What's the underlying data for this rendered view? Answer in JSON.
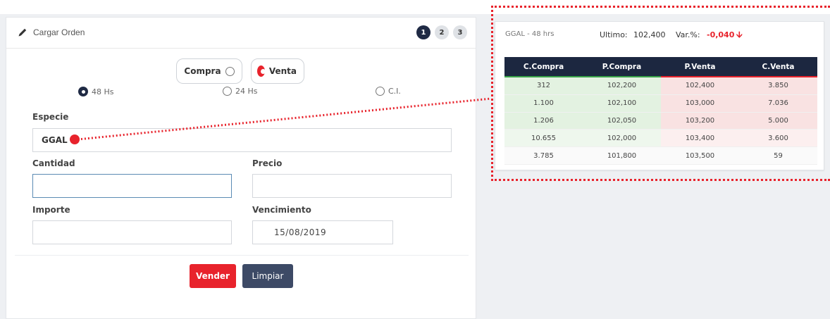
{
  "colors": {
    "accent_red": "#e8232c",
    "dark_navy": "#1c2740",
    "bid_green": "#e3f2e1",
    "ask_red": "#f9e2e2"
  },
  "order_panel": {
    "title": "Cargar Orden",
    "title_icon": "pencil-icon",
    "steps": [
      "1",
      "2",
      "3"
    ],
    "active_step": "1",
    "side_toggle": {
      "buy_label": "Compra",
      "sell_label": "Venta",
      "selected": "Venta"
    },
    "terms": {
      "options": [
        "48 Hs",
        "24 Hs",
        "C.I."
      ],
      "selected": "48 Hs"
    },
    "fields": {
      "especie_label": "Especie",
      "especie_value": "GGAL",
      "cantidad_label": "Cantidad",
      "cantidad_value": "",
      "precio_label": "Precio",
      "precio_value": "",
      "importe_label": "Importe",
      "importe_value": "",
      "vencimiento_label": "Vencimiento",
      "vencimiento_value": "15/08/2019"
    },
    "buttons": {
      "submit": "Vender",
      "clear": "Limpiar"
    }
  },
  "quote_panel": {
    "ticker": "GGAL - 48 hrs",
    "last_label": "Ultimo:",
    "last_value": "102,400",
    "var_label": "Var.%:",
    "var_value": "-0,040",
    "var_icon": "arrow-down-icon",
    "columns": [
      "C.Compra",
      "P.Compra",
      "P.Venta",
      "C.Venta"
    ],
    "rows": [
      [
        "312",
        "102,200",
        "102,400",
        "3.850"
      ],
      [
        "1.100",
        "102,100",
        "103,000",
        "7.036"
      ],
      [
        "1.206",
        "102,050",
        "103,200",
        "5.000"
      ],
      [
        "10.655",
        "102,000",
        "103,400",
        "3.600"
      ],
      [
        "3.785",
        "101,800",
        "103,500",
        "59"
      ]
    ]
  }
}
